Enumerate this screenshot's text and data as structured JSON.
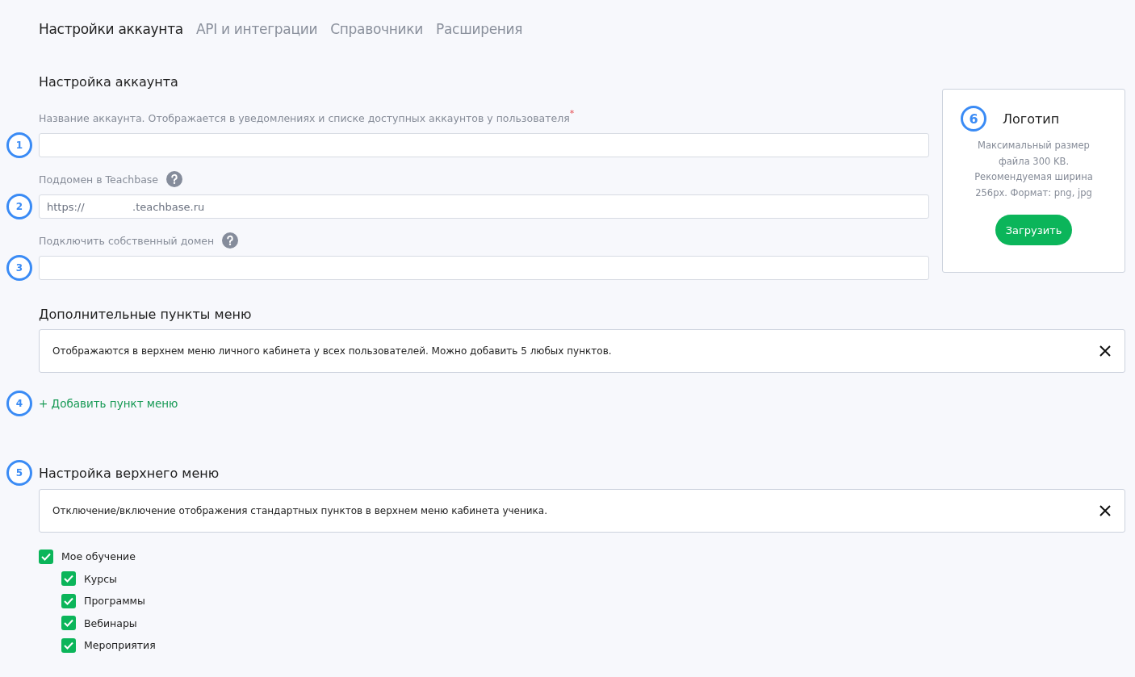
{
  "tabs": [
    {
      "label": "Настройки аккаунта",
      "selected": true
    },
    {
      "label": "API и интеграции",
      "selected": false
    },
    {
      "label": "Справочники",
      "selected": false
    },
    {
      "label": "Расширения",
      "selected": false
    }
  ],
  "account_section": {
    "title": "Настройка аккаунта",
    "fields": [
      {
        "marker": "1",
        "label": "Название аккаунта. Отображается в уведомлениях и списке доступных аккаунтов у пользователя",
        "required_mark": "*",
        "help": false
      },
      {
        "marker": "2",
        "label": "Поддомен в Teachbase",
        "help": true,
        "prefix": "https://",
        "suffix": ".teachbase.ru"
      },
      {
        "marker": "3",
        "label": "Подключить собственный домен",
        "help": true
      }
    ]
  },
  "logo_card": {
    "marker": "6",
    "title": "Логотип",
    "description": "Максимальный размер файла 300 KB. Рекомендуемая ширина 256px. Формат: png, jpg",
    "button": "Загрузить"
  },
  "extra_menu": {
    "title": "Дополнительные пункты меню",
    "notice": "Отображаются в верхнем меню личного кабинета у всех пользователей. Можно добавить 5 любых пунктов.",
    "marker": "4",
    "add_link": "+ Добавить пункт меню"
  },
  "top_menu": {
    "marker": "5",
    "title": "Настройка верхнего меню",
    "notice": "Отключение/включение отображения стандартных пунктов в верхнем меню кабинета ученика.",
    "items": [
      {
        "label": "Мое обучение",
        "checked": true,
        "children": [
          {
            "label": "Курсы",
            "checked": true
          },
          {
            "label": "Программы",
            "checked": true
          },
          {
            "label": "Вебинары",
            "checked": true
          },
          {
            "label": "Мероприятия",
            "checked": true
          }
        ]
      }
    ]
  }
}
